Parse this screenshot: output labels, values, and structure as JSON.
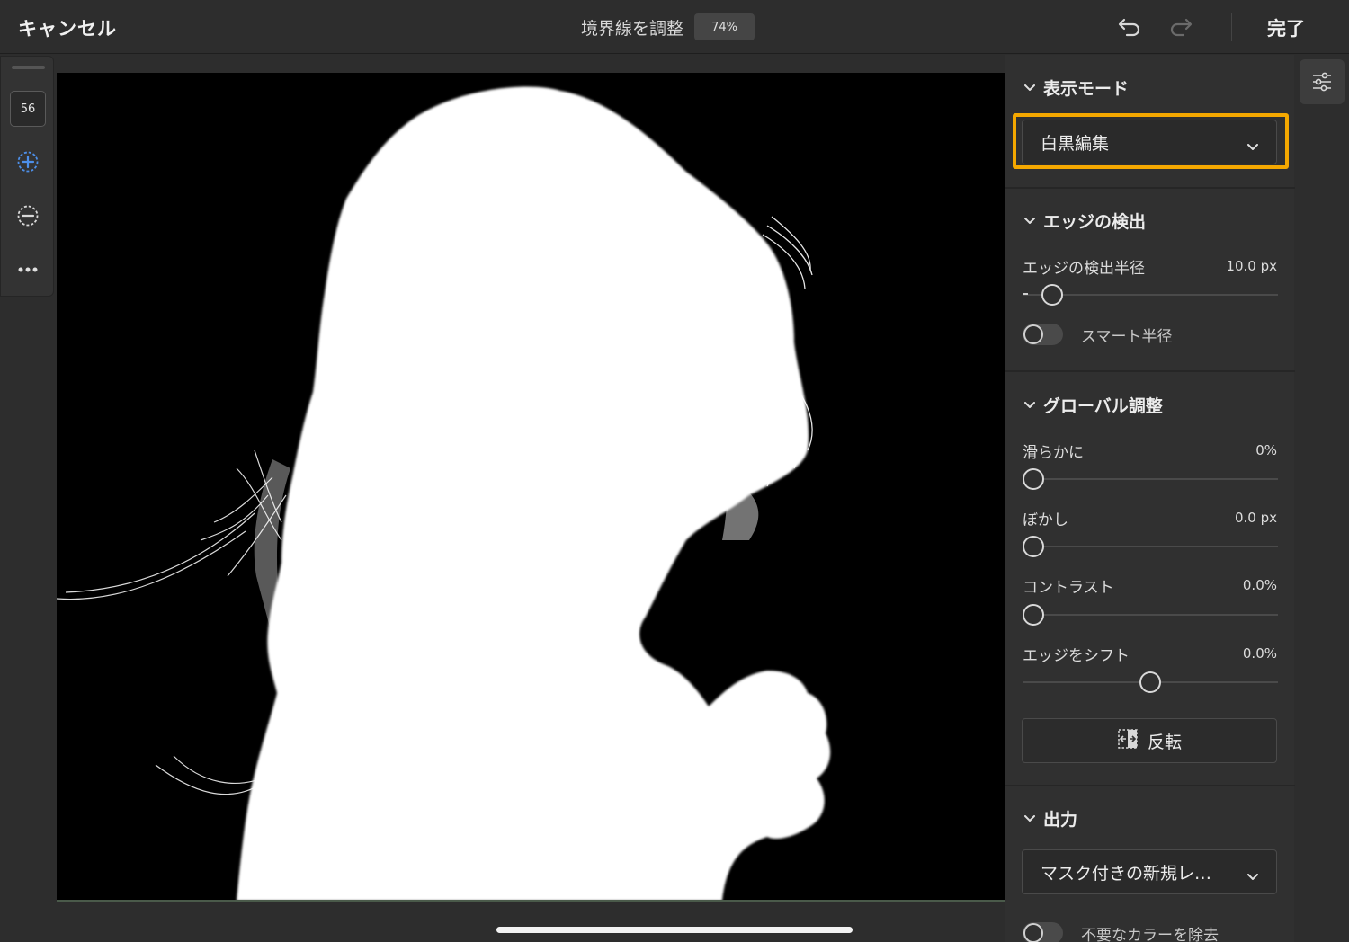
{
  "topbar": {
    "cancel_label": "キャンセル",
    "title": "境界線を調整",
    "zoom_level": "74%",
    "done_label": "完了"
  },
  "tools": {
    "brush_size": "56",
    "add_icon": "circle-plus-icon",
    "subtract_icon": "circle-minus-icon",
    "more_icon": "more-icon"
  },
  "panel": {
    "view_mode": {
      "heading": "表示モード",
      "selected": "白黒編集"
    },
    "edge_detection": {
      "heading": "エッジの検出",
      "radius_label": "エッジの検出半径",
      "radius_value": "10.0 px",
      "radius_fraction": 0.08,
      "smart_radius_label": "スマート半径",
      "smart_radius_on": false
    },
    "global": {
      "heading": "グローバル調整",
      "smooth_label": "滑らかに",
      "smooth_value": "0%",
      "smooth_fraction": 0,
      "feather_label": "ぼかし",
      "feather_value": "0.0 px",
      "feather_fraction": 0,
      "contrast_label": "コントラスト",
      "contrast_value": "0.0%",
      "contrast_fraction": 0,
      "shift_label": "エッジをシフト",
      "shift_value": "0.0%",
      "shift_fraction": 0.5,
      "invert_label": "反転"
    },
    "output": {
      "heading": "出力",
      "selected": "マスク付きの新規レ…",
      "decontaminate_label": "不要なカラーを除去",
      "decontaminate_on": false
    }
  },
  "colors": {
    "highlight": "#f5a800",
    "accent": "#4d8fe8"
  }
}
